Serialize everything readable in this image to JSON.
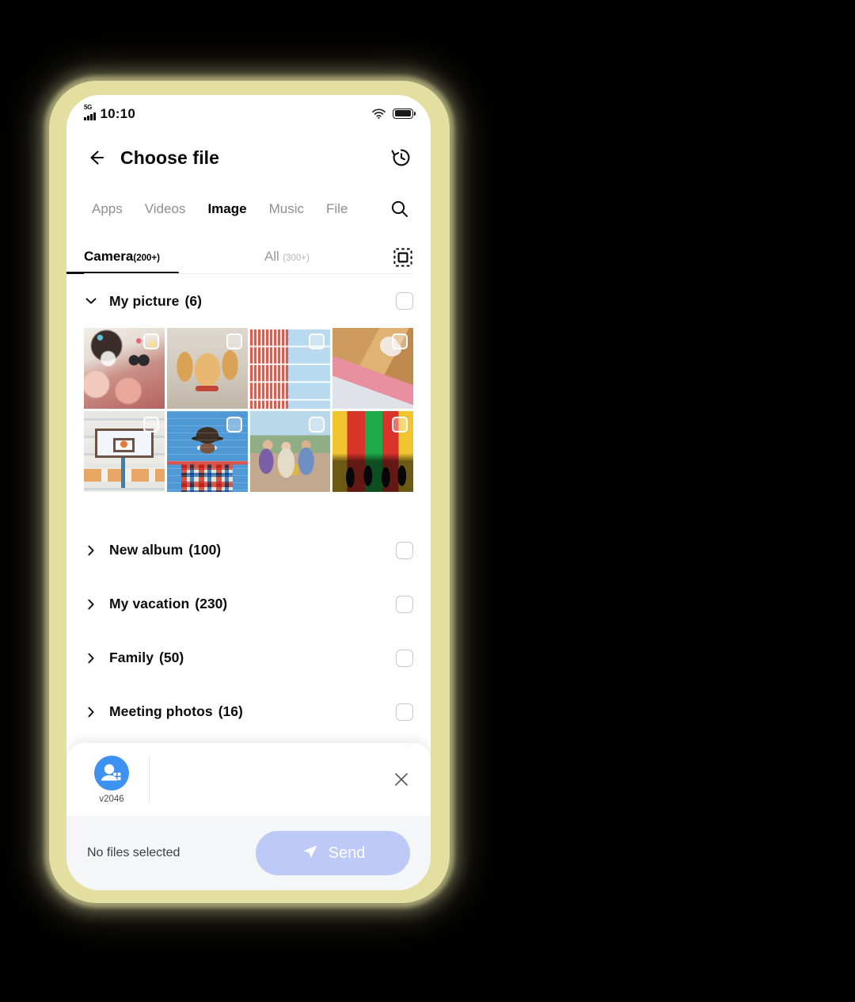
{
  "status_bar": {
    "network": "5G",
    "time": "10:10",
    "wifi_icon": "wifi-icon",
    "battery_icon": "battery-full-icon"
  },
  "app_bar": {
    "back_icon": "arrow-left-icon",
    "title": "Choose file",
    "history_icon": "history-icon"
  },
  "primary_tabs": {
    "items": [
      {
        "label": "Apps",
        "active": false
      },
      {
        "label": "Videos",
        "active": false
      },
      {
        "label": "Image",
        "active": true
      },
      {
        "label": "Music",
        "active": false
      },
      {
        "label": "File",
        "active": false
      }
    ],
    "search_icon": "search-icon"
  },
  "sub_tabs": {
    "camera": {
      "label": "Camera",
      "count": "(200+)",
      "active": true
    },
    "all": {
      "label": "All",
      "count": "(300+)",
      "active": false
    },
    "select_all_icon": "select-all-icon"
  },
  "albums": [
    {
      "name": "My picture",
      "count": "(6)",
      "expanded": true,
      "chevron": "chevron-down-icon"
    },
    {
      "name": "New album",
      "count": "(100)",
      "expanded": false,
      "chevron": "chevron-right-icon"
    },
    {
      "name": "My vacation",
      "count": "(230)",
      "expanded": false,
      "chevron": "chevron-right-icon"
    },
    {
      "name": "Family",
      "count": "(50)",
      "expanded": false,
      "chevron": "chevron-right-icon"
    },
    {
      "name": "Meeting photos",
      "count": "(16)",
      "expanded": false,
      "chevron": "chevron-right-icon"
    }
  ],
  "thumbnails": [
    {
      "alt": "two-people-confetti-sunglasses",
      "selected": false
    },
    {
      "alt": "golden-dog-portrait",
      "selected": false
    },
    {
      "alt": "red-white-building-facade",
      "selected": false
    },
    {
      "alt": "blonde-woman-pink-hoodie",
      "selected": false
    },
    {
      "alt": "basketball-hoop-courtyard",
      "selected": false
    },
    {
      "alt": "man-hat-sunglasses-blue-wall",
      "selected": false
    },
    {
      "alt": "crowd-festival-celebration",
      "selected": false
    },
    {
      "alt": "neon-colored-wall-silhouettes",
      "selected": false
    }
  ],
  "bottom_sheet": {
    "device": {
      "name": "v2046",
      "avatar_icon": "contact-avatar-icon"
    },
    "close_icon": "close-icon",
    "status_text": "No files selected",
    "send": {
      "label": "Send",
      "icon": "send-plane-icon",
      "enabled": false
    }
  },
  "colors": {
    "frame": "#e2dfa0",
    "accent_blue": "#3d91f0",
    "send_disabled": "#bdc9f6",
    "active_text": "#000000",
    "inactive_text": "#8e8e93"
  }
}
